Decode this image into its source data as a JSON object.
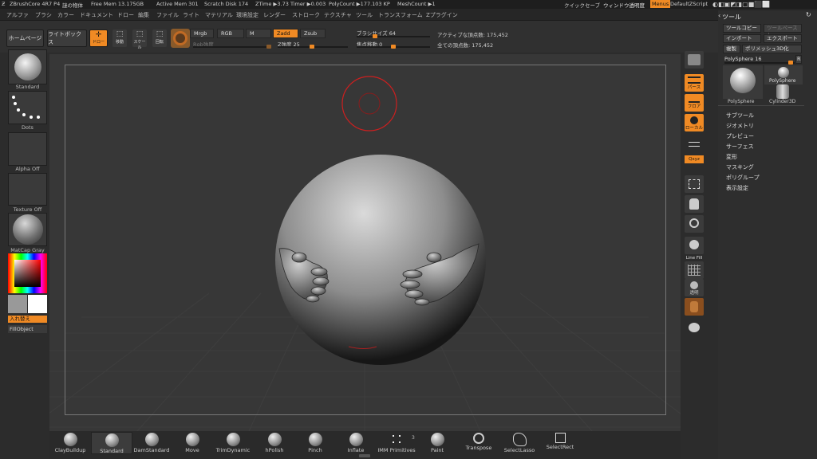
{
  "titlebar": {
    "app": "ZBrushCore 4R7 P4",
    "doc": "謎の物体",
    "free_mem": "Free Mem 13.175GB",
    "active_mem": "Active Mem 301",
    "scratch": "Scratch Disk 174",
    "ztime": "ZTime ▶3.73 Timer ▶0.003",
    "polycount": "PolyCount ▶177.103 KP",
    "meshcount": "MeshCount ▶1",
    "quicksave": "クイックセーブ",
    "transparency": "ウィンドウ透明度",
    "menus": "Menus",
    "script": "DefaultZScript"
  },
  "menubar": {
    "items": [
      "アルファ",
      "ブラシ",
      "カラー",
      "ドキュメント",
      "ドロー",
      "編集",
      "ファイル",
      "ライト",
      "マテリアル",
      "環境設定",
      "レンダー",
      "ストローク",
      "テクスチャ",
      "ツール",
      "トランスフォーム",
      "Zプラグイン"
    ]
  },
  "toolbar": {
    "home": "ホームページ",
    "lightbox": "ライトボックス",
    "draw": "ドロー",
    "move": "移動",
    "scale": "スケール",
    "rotate": "回転",
    "mrgb": "Mrgb",
    "rgb": "RGB",
    "m": "M",
    "zadd": "Zadd",
    "zsub": "Zsub",
    "rgb_intensity": "Rgb強度",
    "z_intensity": "Z強度 25",
    "brush_size": "ブラシサイズ 64",
    "focal_shift": "焦点移動 0",
    "active_points": "アクティブな頂点数: 175,452",
    "total_points": "全ての頂点数: 175,452"
  },
  "left_shelf": {
    "brush": "Standard",
    "stroke": "Dots",
    "alpha": "Alpha Off",
    "texture": "Texture Off",
    "material": "MatCap Gray",
    "swap": "入れ替え",
    "fill": "FillObject"
  },
  "right_shelf": {
    "persp": "パース",
    "floor": "フロア",
    "local": "ローカル",
    "xyz": "Qxyz",
    "lines": "Line Fill",
    "transparent": "透明"
  },
  "tool_panel": {
    "title": "ツール",
    "load": "ツールコピー",
    "paste": "ツールペースト",
    "import": "インポート",
    "export": "エクスポート",
    "clone": "複製",
    "polymesh": "ポリメッシュ3D化",
    "current": "PolySphere 16",
    "r": "R",
    "thumb1": "PolySphere",
    "thumb2": "PolySphere",
    "thumb3": "Cylinder3D",
    "sections": [
      "サブツール",
      "ジオメトリ",
      "プレビュー",
      "サーフェス",
      "変形",
      "マスキング",
      "ポリグループ",
      "表示設定"
    ]
  },
  "bottom_shelf": {
    "brushes": [
      "ClayBuildup",
      "Standard",
      "DamStandard",
      "Move",
      "TrimDynamic",
      "hPolish",
      "Pinch",
      "Inflate",
      "IMM Primitives",
      "Paint",
      "Transpose",
      "SelectLasso",
      "SelectRect"
    ],
    "imm_count": "3"
  },
  "colors": {
    "accent": "#f08a24",
    "panel": "#303030",
    "canvas": "#373737"
  }
}
